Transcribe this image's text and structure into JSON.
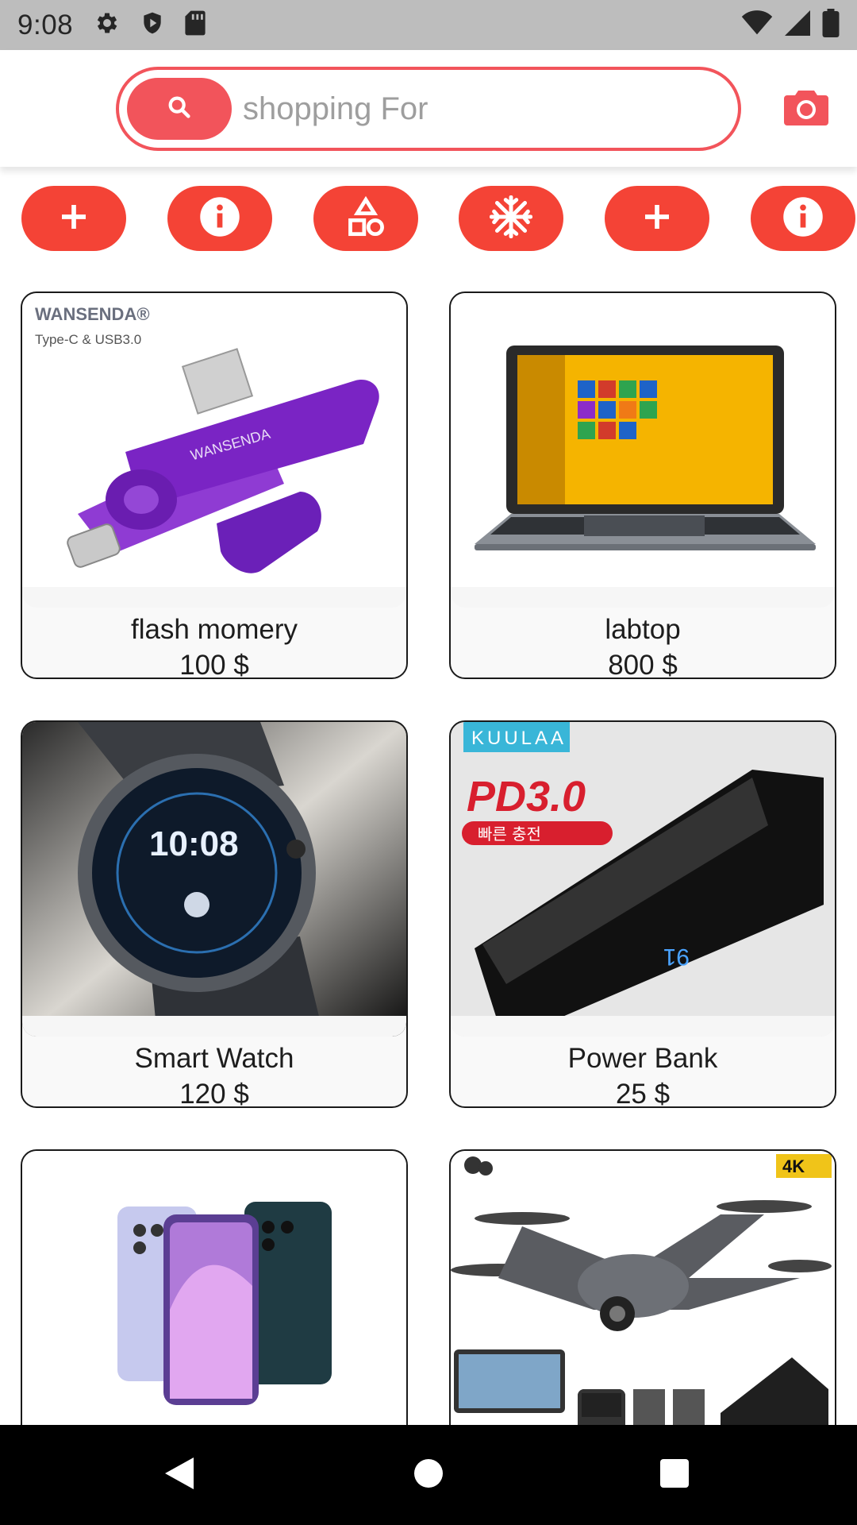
{
  "status_bar": {
    "time": "9:08",
    "left_icons": [
      "settings-icon",
      "shield-icon",
      "sd-card-icon"
    ],
    "right_icons": [
      "wifi-icon",
      "signal-icon",
      "battery-icon"
    ]
  },
  "header": {
    "search_placeholder": "shopping For",
    "search_icon": "search-icon",
    "camera_icon": "camera-icon"
  },
  "categories": [
    {
      "icon": "plus-icon"
    },
    {
      "icon": "info-icon"
    },
    {
      "icon": "shapes-icon"
    },
    {
      "icon": "snowflake-icon"
    },
    {
      "icon": "plus-icon"
    },
    {
      "icon": "info-icon"
    }
  ],
  "products": [
    {
      "name": "flash momery",
      "price": "100 $",
      "brand": "WANSENDA®",
      "subtitle": "Type-C & USB3.0"
    },
    {
      "name": "labtop",
      "price": "800 $"
    },
    {
      "name": "Smart Watch",
      "price": "120 $",
      "watch_time": "10:08"
    },
    {
      "name": "Power Bank",
      "price": "25 $",
      "brand": "KUULAA",
      "badge": "PD3.0",
      "badge_sub": "빠른 충전",
      "display": "91"
    },
    {
      "name": "",
      "price": ""
    },
    {
      "name": "",
      "price": "",
      "badge": "4K"
    }
  ],
  "colors": {
    "accent": "#f44336",
    "search_accent": "#f2545b",
    "status_bar": "#bdbdbd",
    "nav_bar": "#000000"
  }
}
